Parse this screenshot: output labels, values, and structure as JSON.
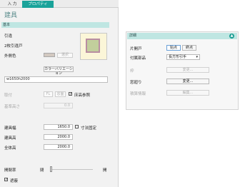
{
  "tabs": [
    "入 力",
    "プロパティ"
  ],
  "panel_title": "建具",
  "section_basic": "基本",
  "basic": {
    "type_label": "引違",
    "subtype_label": "2枚引違戸",
    "outer_color_label": "外側色",
    "color_pick_label": "選択",
    "color_variation_label": "カラーバリエーション",
    "code_value": "w1650h2000",
    "fitting_label": "取付",
    "fl_label": "FL",
    "window_sill_label": "窓面",
    "floor_ref_label": "床高参照",
    "floor_ref_checked": true,
    "base_height_label": "基準高さ",
    "base_height_value": "0.0"
  },
  "dims": {
    "width_label": "建具幅",
    "width_value": "1650.0",
    "fixed_size_label": "寸法固定",
    "fixed_size_checked": false,
    "height_label": "建具高",
    "height_value": "2000.0",
    "total_height_label": "全体高",
    "total_height_value": "2000.0"
  },
  "opening": {
    "label": "開閉率",
    "closed_label": "閉",
    "open_label": "開",
    "level": 0.0
  },
  "shading": {
    "label": "遮蔽",
    "checked": true
  },
  "detail": {
    "header": "詳細",
    "single_door_label": "片開戸",
    "start_label": "始点",
    "end_label": "終点",
    "hardware_label": "付属部品",
    "hardware_value": "長方形引手",
    "frame_label": "枠",
    "frame_button": "変更...",
    "window_frame_label": "窓廻り",
    "window_frame_button": "変更...",
    "estimate_label": "積算情報",
    "estimate_button": "編集..."
  },
  "colors": {
    "accent": "#1aa39a",
    "section_bg": "#bfe6e2",
    "thumb_door": "#c2cf9c",
    "thumb_frame": "#b98ea2"
  }
}
